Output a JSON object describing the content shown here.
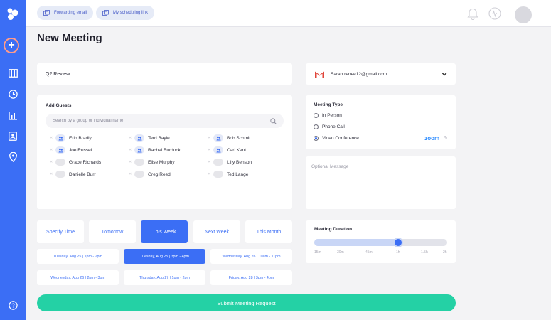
{
  "app": {
    "page_title": "New Meeting"
  },
  "topbar": {
    "forwarding_label": "Forwarding email",
    "scheduling_label": "My scheduling link"
  },
  "meeting": {
    "title_value": "Q2 Review",
    "email": "Sarah.renee12@gmail.com"
  },
  "guests": {
    "heading": "Add Guests",
    "search_placeholder": "Search by a group or individual name",
    "people": [
      {
        "name": "Erin Bradly",
        "active": true
      },
      {
        "name": "Terri Bayle",
        "active": true
      },
      {
        "name": "Bob Schmit",
        "active": true
      },
      {
        "name": "Joe Russel",
        "active": true
      },
      {
        "name": "Rachel Burdock",
        "active": true
      },
      {
        "name": "Carl Kent",
        "active": true
      },
      {
        "name": "Grace Richards",
        "active": false
      },
      {
        "name": "Elise Murphy",
        "active": false
      },
      {
        "name": "Lilly Benson",
        "active": false
      },
      {
        "name": "Danielle Burr",
        "active": false
      },
      {
        "name": "Greg Reed",
        "active": false
      },
      {
        "name": "Ted Lange",
        "active": false
      }
    ]
  },
  "meeting_type": {
    "heading": "Meeting Type",
    "options": [
      "In Person",
      "Phone Call",
      "Video Conference"
    ],
    "selected": "Video Conference",
    "provider": "zoom"
  },
  "optional_message": {
    "placeholder": "Optional Message"
  },
  "time_filters": {
    "options": [
      "Specify Time",
      "Tomorrow",
      "This Week",
      "Next Week",
      "This Month"
    ],
    "selected": "This Week"
  },
  "slots": [
    {
      "label": "Tuesday, Aug 25 | 1pm - 2pm",
      "active": false
    },
    {
      "label": "Tuesday, Aug 25 | 3pm - 4pm",
      "active": true
    },
    {
      "label": "Wednesday, Aug 26 | 10am - 11pm",
      "active": false
    },
    {
      "label": "Wednesday, Aug 26 | 2pm - 3pm",
      "active": false
    },
    {
      "label": "Thursday, Aug 27 | 1pm - 2pm",
      "active": false
    },
    {
      "label": "Friday, Aug 28 | 3pm - 4pm",
      "active": false
    }
  ],
  "duration": {
    "heading": "Meeting Duration",
    "ticks": [
      "15m",
      "30m",
      "45m",
      "1h",
      "1.5h",
      "2h"
    ],
    "value_fraction": 0.63
  },
  "submit_label": "Submit Meeting Request",
  "colors": {
    "accent": "#3b6ef5",
    "submit": "#24d1a5",
    "zoom": "#2d8cff"
  }
}
